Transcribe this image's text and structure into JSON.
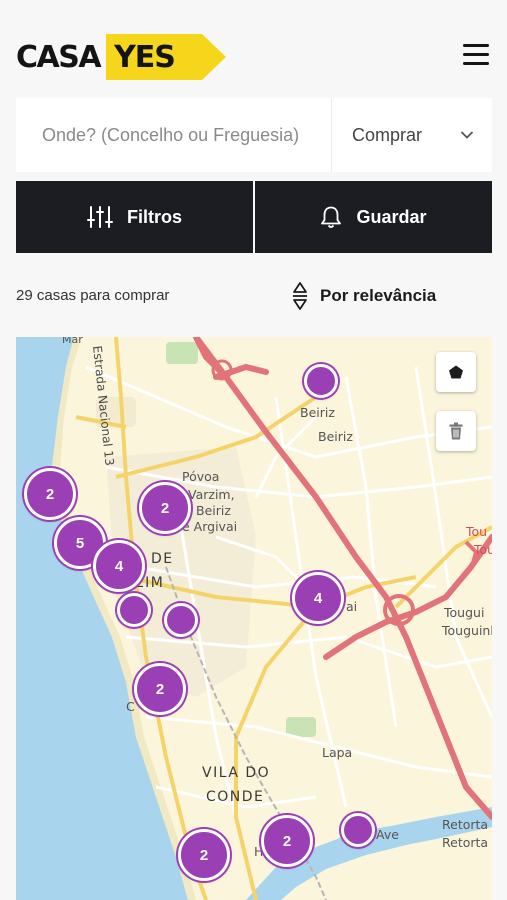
{
  "header": {
    "logo_part1": "CASA",
    "logo_part2": "YES",
    "menu_icon": "hamburger-menu-icon",
    "brand_color": "#f5d61a"
  },
  "search": {
    "placeholder": "Onde? (Concelho ou Freguesia)",
    "value": "",
    "transaction_select": {
      "selected": "Comprar",
      "icon": "chevron-down-icon"
    }
  },
  "actions": {
    "filters_label": "Filtros",
    "filters_icon": "sliders-icon",
    "save_label": "Guardar",
    "save_icon": "bell-icon"
  },
  "results": {
    "count_text": "29 casas para comprar",
    "sort_label": "Por relevância",
    "sort_icon": "sort-arrows-icon"
  },
  "map": {
    "tools": [
      {
        "name": "draw-polygon-icon"
      },
      {
        "name": "trash-icon"
      }
    ],
    "labels": {
      "beiriz_1": "Beiriz",
      "beiriz_2": "Beiriz",
      "estrada": "Estrada Nacional 13",
      "povoa_1": "Póvoa",
      "povoa_2": "Varzim,",
      "povoa_3": "Beiriz",
      "povoa_4": "e Argivai",
      "town_povoa_1": "A DE",
      "town_povoa_2": "ZIM",
      "touguinha_1": "Tougui",
      "touguinha_2": "Touguinh",
      "tou_red_1": "Tou",
      "tou_red_2": "Tou",
      "lapa": "Lapa",
      "vila_1": "VILA DO",
      "vila_2": "CONDE",
      "ave": "Ave",
      "retorta_1": "Retorta",
      "retorta_2": "Retorta",
      "argivai_suffix": "ai",
      "ca": "C",
      "h": "H",
      "mar": "Mar"
    },
    "clusters": [
      {
        "count": ""
      },
      {
        "count": "2"
      },
      {
        "count": "2"
      },
      {
        "count": "5"
      },
      {
        "count": "4"
      },
      {
        "count": ""
      },
      {
        "count": ""
      },
      {
        "count": "4"
      },
      {
        "count": "2"
      },
      {
        "count": "2"
      },
      {
        "count": "2"
      },
      {
        "count": ""
      }
    ],
    "cluster_color": "#9b3fb5"
  }
}
